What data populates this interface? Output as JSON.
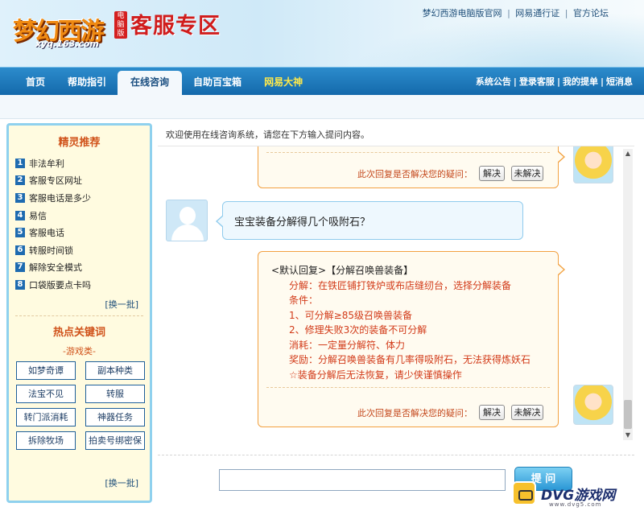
{
  "header": {
    "logo_text": "梦幻西游",
    "logo_badge": "电脑版",
    "logo_url": "xyq.163.com",
    "title": "客服专区",
    "top_links": [
      "梦幻西游电脑版官网",
      "网易通行证",
      "官方论坛"
    ],
    "top_sep": "|"
  },
  "nav": {
    "tabs": [
      {
        "label": "首页"
      },
      {
        "label": "帮助指引"
      },
      {
        "label": "在线咨询"
      },
      {
        "label": "自助百宝箱"
      },
      {
        "label": "网易大神"
      }
    ],
    "right_links": [
      "系统公告",
      "登录客服",
      "我的提单",
      "短消息"
    ],
    "sep": "|"
  },
  "sidebar": {
    "recommend_title": "精灵推荐",
    "recommend": [
      {
        "num": "1",
        "label": "非法牟利"
      },
      {
        "num": "2",
        "label": "客服专区网址"
      },
      {
        "num": "3",
        "label": "客服电话是多少"
      },
      {
        "num": "4",
        "label": "易信"
      },
      {
        "num": "5",
        "label": "客服电话"
      },
      {
        "num": "6",
        "label": "转服时间锁"
      },
      {
        "num": "7",
        "label": "解除安全模式"
      },
      {
        "num": "8",
        "label": "口袋版要点卡吗"
      }
    ],
    "more_label": "[换一批]",
    "hot_title": "热点关键词",
    "category": "-游戏类-",
    "keywords": [
      "如梦奇谭",
      "副本种类",
      "法宝不见",
      "转服",
      "转门派消耗",
      "神器任务",
      "拆除牧场",
      "拍卖号绑密保"
    ],
    "more_label2": "[换一批]"
  },
  "chat": {
    "welcome": "欢迎使用在线咨询系统，请您在下方输入提问内容。",
    "feedback_prompt": "此次回复是否解决您的疑问：",
    "solved_label": "解决",
    "unsolved_label": "未解决",
    "user_question": "宝宝装备分解得几个吸附石？",
    "reply_title": "<默认回复>【分解召唤兽装备】",
    "reply_lines": [
      "分解：在铁匠铺打铁炉或布店缝纫台，选择分解装备",
      "条件：",
      "1、可分解≥85级召唤兽装备",
      "2、修理失败3次的装备不可分解",
      "消耗：一定量分解符、体力",
      "奖励：分解召唤兽装备有几率得吸附石，无法获得炼妖石",
      "☆装备分解后无法恢复，请少侠谨慎操作"
    ]
  },
  "input": {
    "value": "",
    "placeholder": "",
    "submit_label": "提 问"
  },
  "watermark": {
    "text": "DVG游戏网",
    "sub": "www.dvg5.com"
  },
  "colors": {
    "nav_bg": "#1a74b6",
    "accent_orange": "#f2a141",
    "reply_red": "#d23a18",
    "title_red": "#d01c1c"
  }
}
